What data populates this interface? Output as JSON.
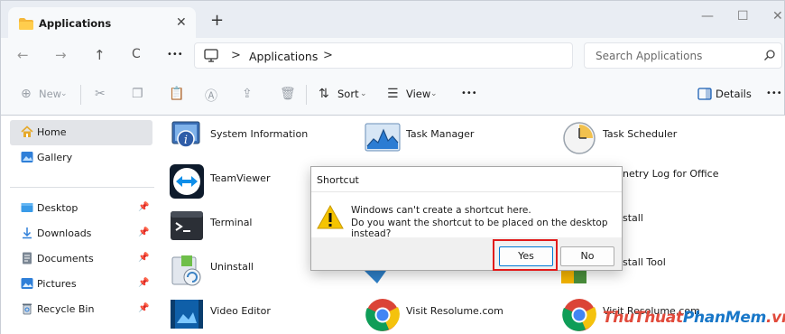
{
  "window": {
    "tab_title": "Applications",
    "tab_close": "✕",
    "new_tab": "+",
    "minimize": "—",
    "maximize": "☐",
    "close": "✕"
  },
  "address": {
    "back": "←",
    "forward": "→",
    "up": "↑",
    "refresh": "C",
    "more": "•••",
    "separator": ">",
    "breadcrumb": "Applications",
    "search_placeholder": "Search Applications"
  },
  "toolbar": {
    "new_label": "New",
    "sort_label": "Sort",
    "view_label": "View",
    "more": "•••",
    "details_label": "Details",
    "more_right": "•••"
  },
  "sidebar": {
    "items": [
      {
        "label": "Home",
        "icon": "home-icon"
      },
      {
        "label": "Gallery",
        "icon": "gallery-icon"
      },
      {
        "label": "Desktop",
        "icon": "desktop-icon"
      },
      {
        "label": "Downloads",
        "icon": "download-icon"
      },
      {
        "label": "Documents",
        "icon": "document-icon"
      },
      {
        "label": "Pictures",
        "icon": "pictures-icon"
      },
      {
        "label": "Recycle Bin",
        "icon": "recycle-bin-icon"
      }
    ]
  },
  "files": [
    {
      "name": "System Information"
    },
    {
      "name": "Task Manager"
    },
    {
      "name": "Task Scheduler"
    },
    {
      "name": "TeamViewer"
    },
    {
      "name": "netry Log for Office"
    },
    {
      "name": "Terminal"
    },
    {
      "name": "stall"
    },
    {
      "name": "Uninstall"
    },
    {
      "name": "stall Tool"
    },
    {
      "name": "Video Editor"
    },
    {
      "name": "Visit Resolume.com"
    },
    {
      "name": "Visit Resolume.com"
    }
  ],
  "dialog": {
    "title": "Shortcut",
    "line1": "Windows can't create a shortcut here.",
    "line2": "Do you want the shortcut to be placed on the desktop instead?",
    "yes": "Yes",
    "no": "No"
  },
  "watermark": {
    "part1": "ThuThuat",
    "part2": "PhanMem",
    "part3": ".vn"
  },
  "colors": {
    "accent": "#0078d4",
    "highlight": "#e11b1b",
    "warning": "#f5c400"
  }
}
